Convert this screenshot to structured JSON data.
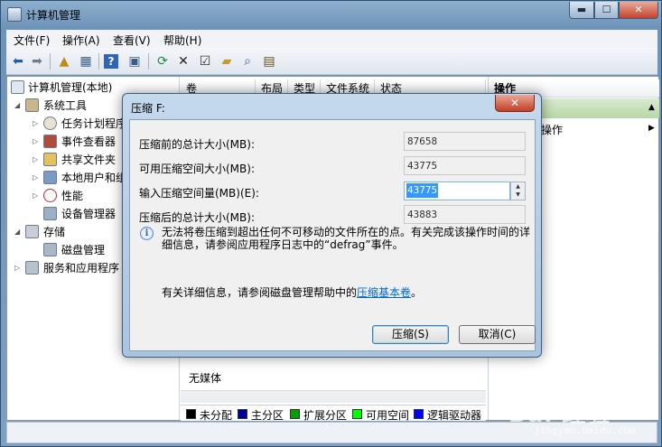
{
  "window": {
    "title": "计算机管理",
    "min_glyph": "▬",
    "max_glyph": "☐",
    "close_glyph": "✕"
  },
  "menu": [
    "文件(F)",
    "操作(A)",
    "查看(V)",
    "帮助(H)"
  ],
  "tree": {
    "root": "计算机管理(本地)",
    "system_tools": "系统工具",
    "items": [
      "任务计划程序",
      "事件查看器",
      "共享文件夹",
      "本地用户和组",
      "性能",
      "设备管理器"
    ],
    "storage": "存储",
    "disk_mgmt": "磁盘管理",
    "services": "服务和应用程序"
  },
  "columns": [
    "卷",
    "布局",
    "类型",
    "文件系统",
    "状态"
  ],
  "disk_view": {
    "no_media": "无媒体"
  },
  "legend": [
    {
      "label": "未分配",
      "color": "#000000"
    },
    {
      "label": "主分区",
      "color": "#0000a0"
    },
    {
      "label": "扩展分区",
      "color": "#00a000"
    },
    {
      "label": "可用空间",
      "color": "#00ff00"
    },
    {
      "label": "逻辑驱动器",
      "color": "#0000ff"
    }
  ],
  "actions": {
    "header": "操作",
    "more": "操作"
  },
  "dialog": {
    "title": "压缩 F:",
    "close_glyph": "✕",
    "fields": [
      {
        "label": "压缩前的总计大小(MB):",
        "value": "87658"
      },
      {
        "label": "可用压缩空间大小(MB):",
        "value": "43775"
      },
      {
        "label": "输入压缩空间量(MB)(E):",
        "value": "43775"
      },
      {
        "label": "压缩后的总计大小(MB):",
        "value": "43883"
      }
    ],
    "info_icon": "info-icon",
    "info_glyph": "i",
    "warning": "无法将卷压缩到超出任何不可移动的文件所在的点。有关完成该操作时间的详细信息，请参阅应用程序日志中的“defrag”事件。",
    "help_prefix": "有关详细信息，请参阅磁盘管理帮助中的",
    "help_link": "压缩基本卷",
    "help_suffix": "。",
    "shrink_button": "压缩(S)",
    "cancel_button": "取消(C)"
  },
  "watermark": {
    "text": "Bai 经验",
    "sub": "jingyan.baidu.com"
  }
}
